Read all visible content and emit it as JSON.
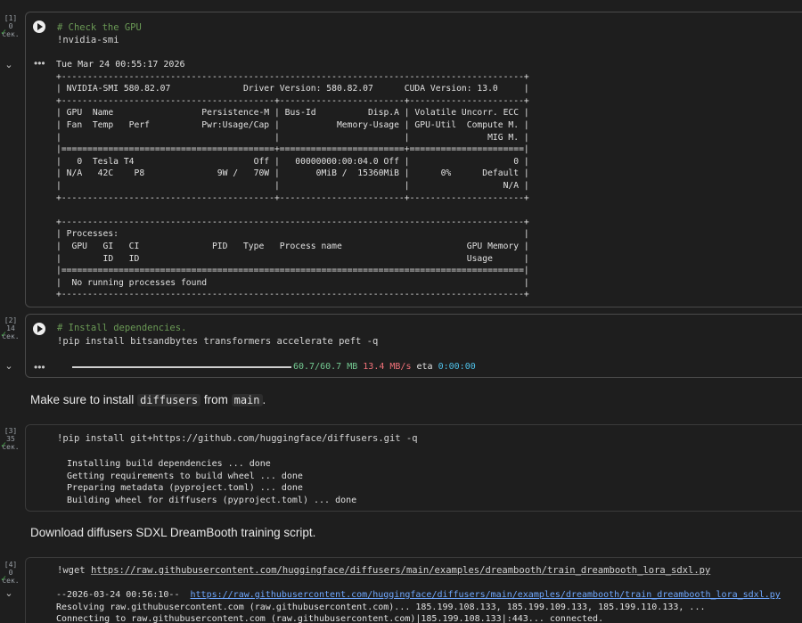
{
  "cells": [
    {
      "exec_count": "[1]",
      "duration": "0",
      "duration_unit": "сек.",
      "source": [
        "# Check the GPU",
        "!nvidia-smi"
      ],
      "output": [
        "Tue Mar 24 00:55:17 2026",
        "+-----------------------------------------------------------------------------------------+",
        "| NVIDIA-SMI 580.82.07              Driver Version: 580.82.07      CUDA Version: 13.0     |",
        "+-----------------------------------------+------------------------+----------------------+",
        "| GPU  Name                 Persistence-M | Bus-Id          Disp.A | Volatile Uncorr. ECC |",
        "| Fan  Temp   Perf          Pwr:Usage/Cap |           Memory-Usage | GPU-Util  Compute M. |",
        "|                                         |                        |               MIG M. |",
        "|=========================================+========================+======================|",
        "|   0  Tesla T4                       Off |   00000000:00:04.0 Off |                    0 |",
        "| N/A   42C    P8              9W /   70W |       0MiB /  15360MiB |      0%      Default |",
        "|                                         |                        |                  N/A |",
        "+-----------------------------------------+------------------------+----------------------+",
        "",
        "+-----------------------------------------------------------------------------------------+",
        "| Processes:                                                                              |",
        "|  GPU   GI   CI              PID   Type   Process name                        GPU Memory |",
        "|        ID   ID                                                               Usage      |",
        "|=========================================================================================|",
        "|  No running processes found                                                             |",
        "+-----------------------------------------------------------------------------------------+"
      ]
    },
    {
      "exec_count": "[2]",
      "duration": "14",
      "duration_unit": "сек.",
      "source": [
        "# Install dependencies.",
        "!pip install bitsandbytes transformers accelerate peft -q"
      ],
      "progress": {
        "fraction": 1.0,
        "size": "60.7/60.7 MB",
        "speed": "13.4 MB/s",
        "eta_label": "eta",
        "eta": "0:00:00"
      }
    },
    {
      "md_parts": [
        "Make sure to install ",
        "diffusers",
        " from ",
        "main",
        "."
      ]
    },
    {
      "exec_count": "[3]",
      "duration": "35",
      "duration_unit": "сек.",
      "source": [
        "!pip install git+https://github.com/huggingface/diffusers.git -q"
      ],
      "output": [
        "  Installing build dependencies ... done",
        "  Getting requirements to build wheel ... done",
        "  Preparing metadata (pyproject.toml) ... done",
        "  Building wheel for diffusers (pyproject.toml) ... done"
      ]
    },
    {
      "md_text": "Download diffusers SDXL DreamBooth training script."
    },
    {
      "exec_count": "[4]",
      "duration": "0",
      "duration_unit": "сек.",
      "source_prefix": "!wget ",
      "source_url": "https://raw.githubusercontent.com/huggingface/diffusers/main/examples/dreambooth/train_dreambooth_lora_sdxl.py",
      "output_line1_prefix": "--2026-03-24 00:56:10--  ",
      "output_line1_url": "https://raw.githubusercontent.com/huggingface/diffusers/main/examples/dreambooth/train_dreambooth_lora_sdxl.py",
      "output_line2": "Resolving raw.githubusercontent.com (raw.githubusercontent.com)... 185.199.108.133, 185.199.109.133, 185.199.110.133, ...",
      "output_line3": "Connecting to raw.githubusercontent.com (raw.githubusercontent.com)|185.199.108.133|:443... connected."
    }
  ],
  "colors": {
    "comment": "#6a9955",
    "progress_done": "#73c991",
    "progress_speed": "#f07178",
    "progress_eta": "#4fc1e9",
    "link": "#6fa8ff"
  }
}
